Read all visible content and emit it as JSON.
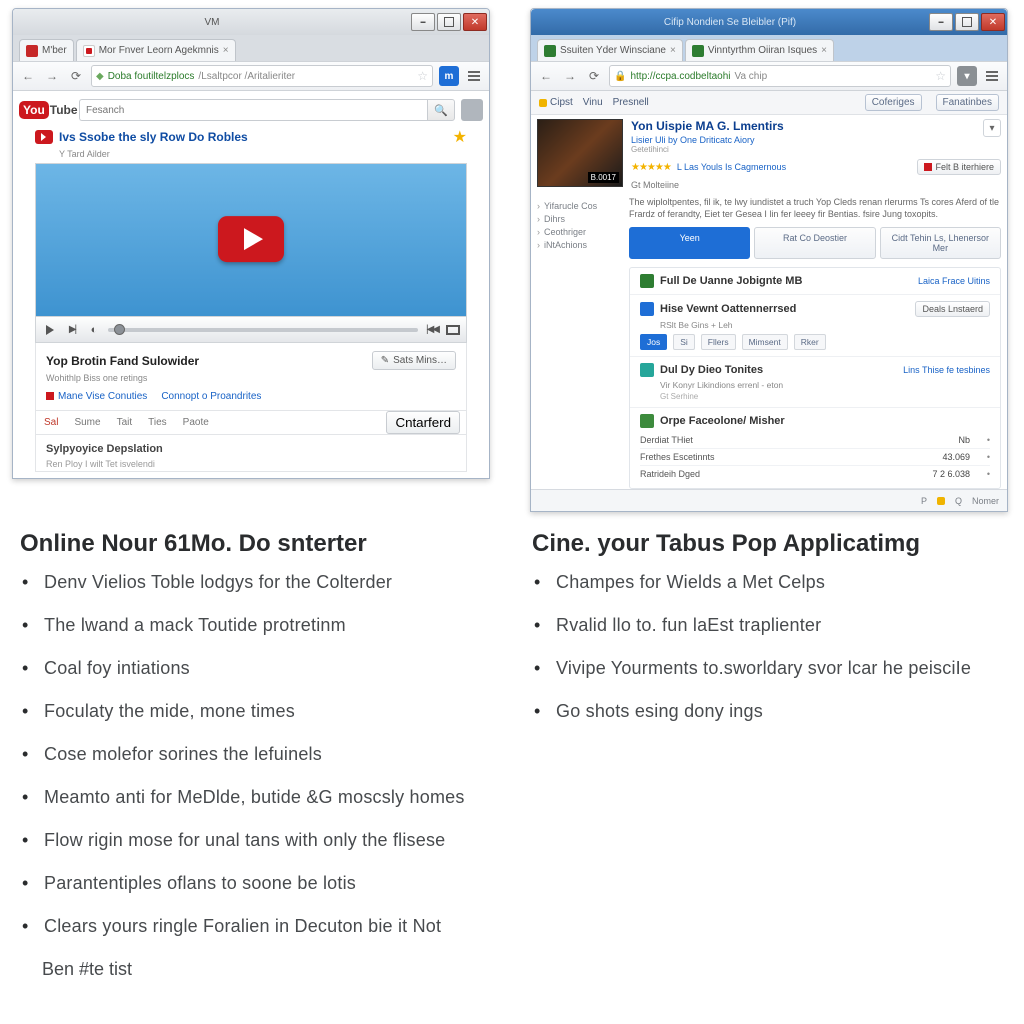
{
  "left": {
    "chrome": {
      "title_center": "VM",
      "tabs": [
        {
          "favicon": "red",
          "label": "M'ber"
        },
        {
          "favicon": "yt",
          "label": "Mor Fnver Leorn Agekmnis"
        }
      ],
      "url_lock": "D",
      "url_main": "Doba foutiltelzplocs",
      "url_tail": "/Lsaltpcor /Aritalieriter"
    },
    "yt": {
      "search_placeholder": "Fesanch",
      "video_title": "Ivs Ssobe the sly Row Do Robles",
      "video_sub": "Y Tard Ailder",
      "below_title": "Yop Brotin Fand Sulowider",
      "below_sub": "Wohithlp Biss one retings",
      "save_btn": "Sats Mins…",
      "link1": "Mane Vise Conuties",
      "link2": "Connopt o Proandrites",
      "tabs": [
        "Sal",
        "Sume",
        "Tait",
        "Ties",
        "Paote"
      ],
      "btn_r": "Cntarferd",
      "desc_title": "Sylpyoyice Depslation",
      "desc_more": "Ren Ploy I wilt Tet isvelendi"
    },
    "bookmarks_btn_text": ""
  },
  "right": {
    "chrome": {
      "title_center": "Cifip Nondien Se Bleibler (Pif)",
      "tabs": [
        {
          "favicon": "green",
          "label": "Ssuiten Yder Winsciane"
        },
        {
          "favicon": "green",
          "label": "Vinntyrthm Oiiran Isques"
        }
      ],
      "url_main": "http://ccpa.codbeltaohi",
      "url_tail": "Va chip"
    },
    "bookmarks": {
      "items": [
        "Vinu",
        "Presnell"
      ],
      "left_icon": "Cipst",
      "btn1": "Coferiges",
      "btn2": "Fanatinbes"
    },
    "meta": {
      "title": "Yon Uispie MA G. Lmentirs",
      "sub": "Lisier Uli by One Driticatc Aiory",
      "sub2": "Getetihinci",
      "rating_text": "L Las Youls Is Cagmernous",
      "btn": "Felt B iterhiere",
      "go": "Gt Molteiine",
      "duration": "B.0017"
    },
    "side_items": [
      "Yifarucle Cos",
      "Dihrs",
      "Ceothriger",
      "iNtAchions"
    ],
    "desc": "The wiploltpentes, fil ik, te lwy iundistet a truch Yop Cleds renan rlerurms Ts cores Aferd of tle Frardz of ferandty, Eiet ter Gesea I lin fer leeey fir Bentias. fsire Jung toxopits.",
    "segs": [
      "Yeen",
      "Rat Co Deostier",
      "Cidt Tehin Ls, Lhenersor Mer"
    ],
    "items": [
      {
        "icon": "green",
        "title": "Full De Uanne Jobignte MB",
        "link": "Laica Frace Uitins",
        "sub": "",
        "sub2": ""
      },
      {
        "icon": "blue",
        "title": "Hise Vewnt Oattennerrsed",
        "btn": "Deals Lnstaerd",
        "sub": "RSlt Be Gins + Leh",
        "sub2": "",
        "mini": [
          "Jos",
          "Si",
          "Fllers",
          "Mimsent",
          "Rker"
        ]
      },
      {
        "icon": "teal",
        "title": "Dul Dy Dieo Tonites",
        "link": "Lins Thise fe tesbines",
        "sub": "Vir Konyr Likindions errenl - eton",
        "sub2": "Gt Serhine"
      },
      {
        "icon": "forest",
        "title": "Orpe Faceolone/ Misher",
        "link": "",
        "table": [
          {
            "c1": "Derdiat THiet",
            "c2": "Nb",
            "c3": "•"
          },
          {
            "c1": "Frethes Escetinnts",
            "c2": "43.069",
            "c3": "•"
          },
          {
            "c1": "Ratrideih Dged",
            "c2": "7 2 6.038",
            "c3": "•"
          }
        ]
      }
    ],
    "status": [
      "P",
      "Q",
      "Nomer"
    ]
  },
  "articles": {
    "left": {
      "heading": "Online Nour 61Mo. Do snterter",
      "bullets": [
        "Denv Vielios Toble lodgys for the Colterder",
        "The lwand a mack Toutide protretinm",
        "Coal foy intiations",
        "Foculaty the mide, mone times",
        "Cose molefor sorines the lefuinels",
        "Meamto anti for MeDlde, butide &G moscsly homes",
        "Flow rigin mose for unal tans with only the flisese",
        "Parantentiples oflans to soone be lotis",
        "Clears yours ringle Foralien in Decuton bie it Not"
      ],
      "tail": "Ben #te tist"
    },
    "right": {
      "heading": "Cine. your Tabus Pop Applicatimg",
      "bullets": [
        "Champes for Wields a Met Celps",
        "Rvalid llo to. fun laEst traplienter",
        "Vivipe Yourments to.sworldary svor lcar he peisciIe",
        "Go shots esing dony ings"
      ]
    }
  }
}
